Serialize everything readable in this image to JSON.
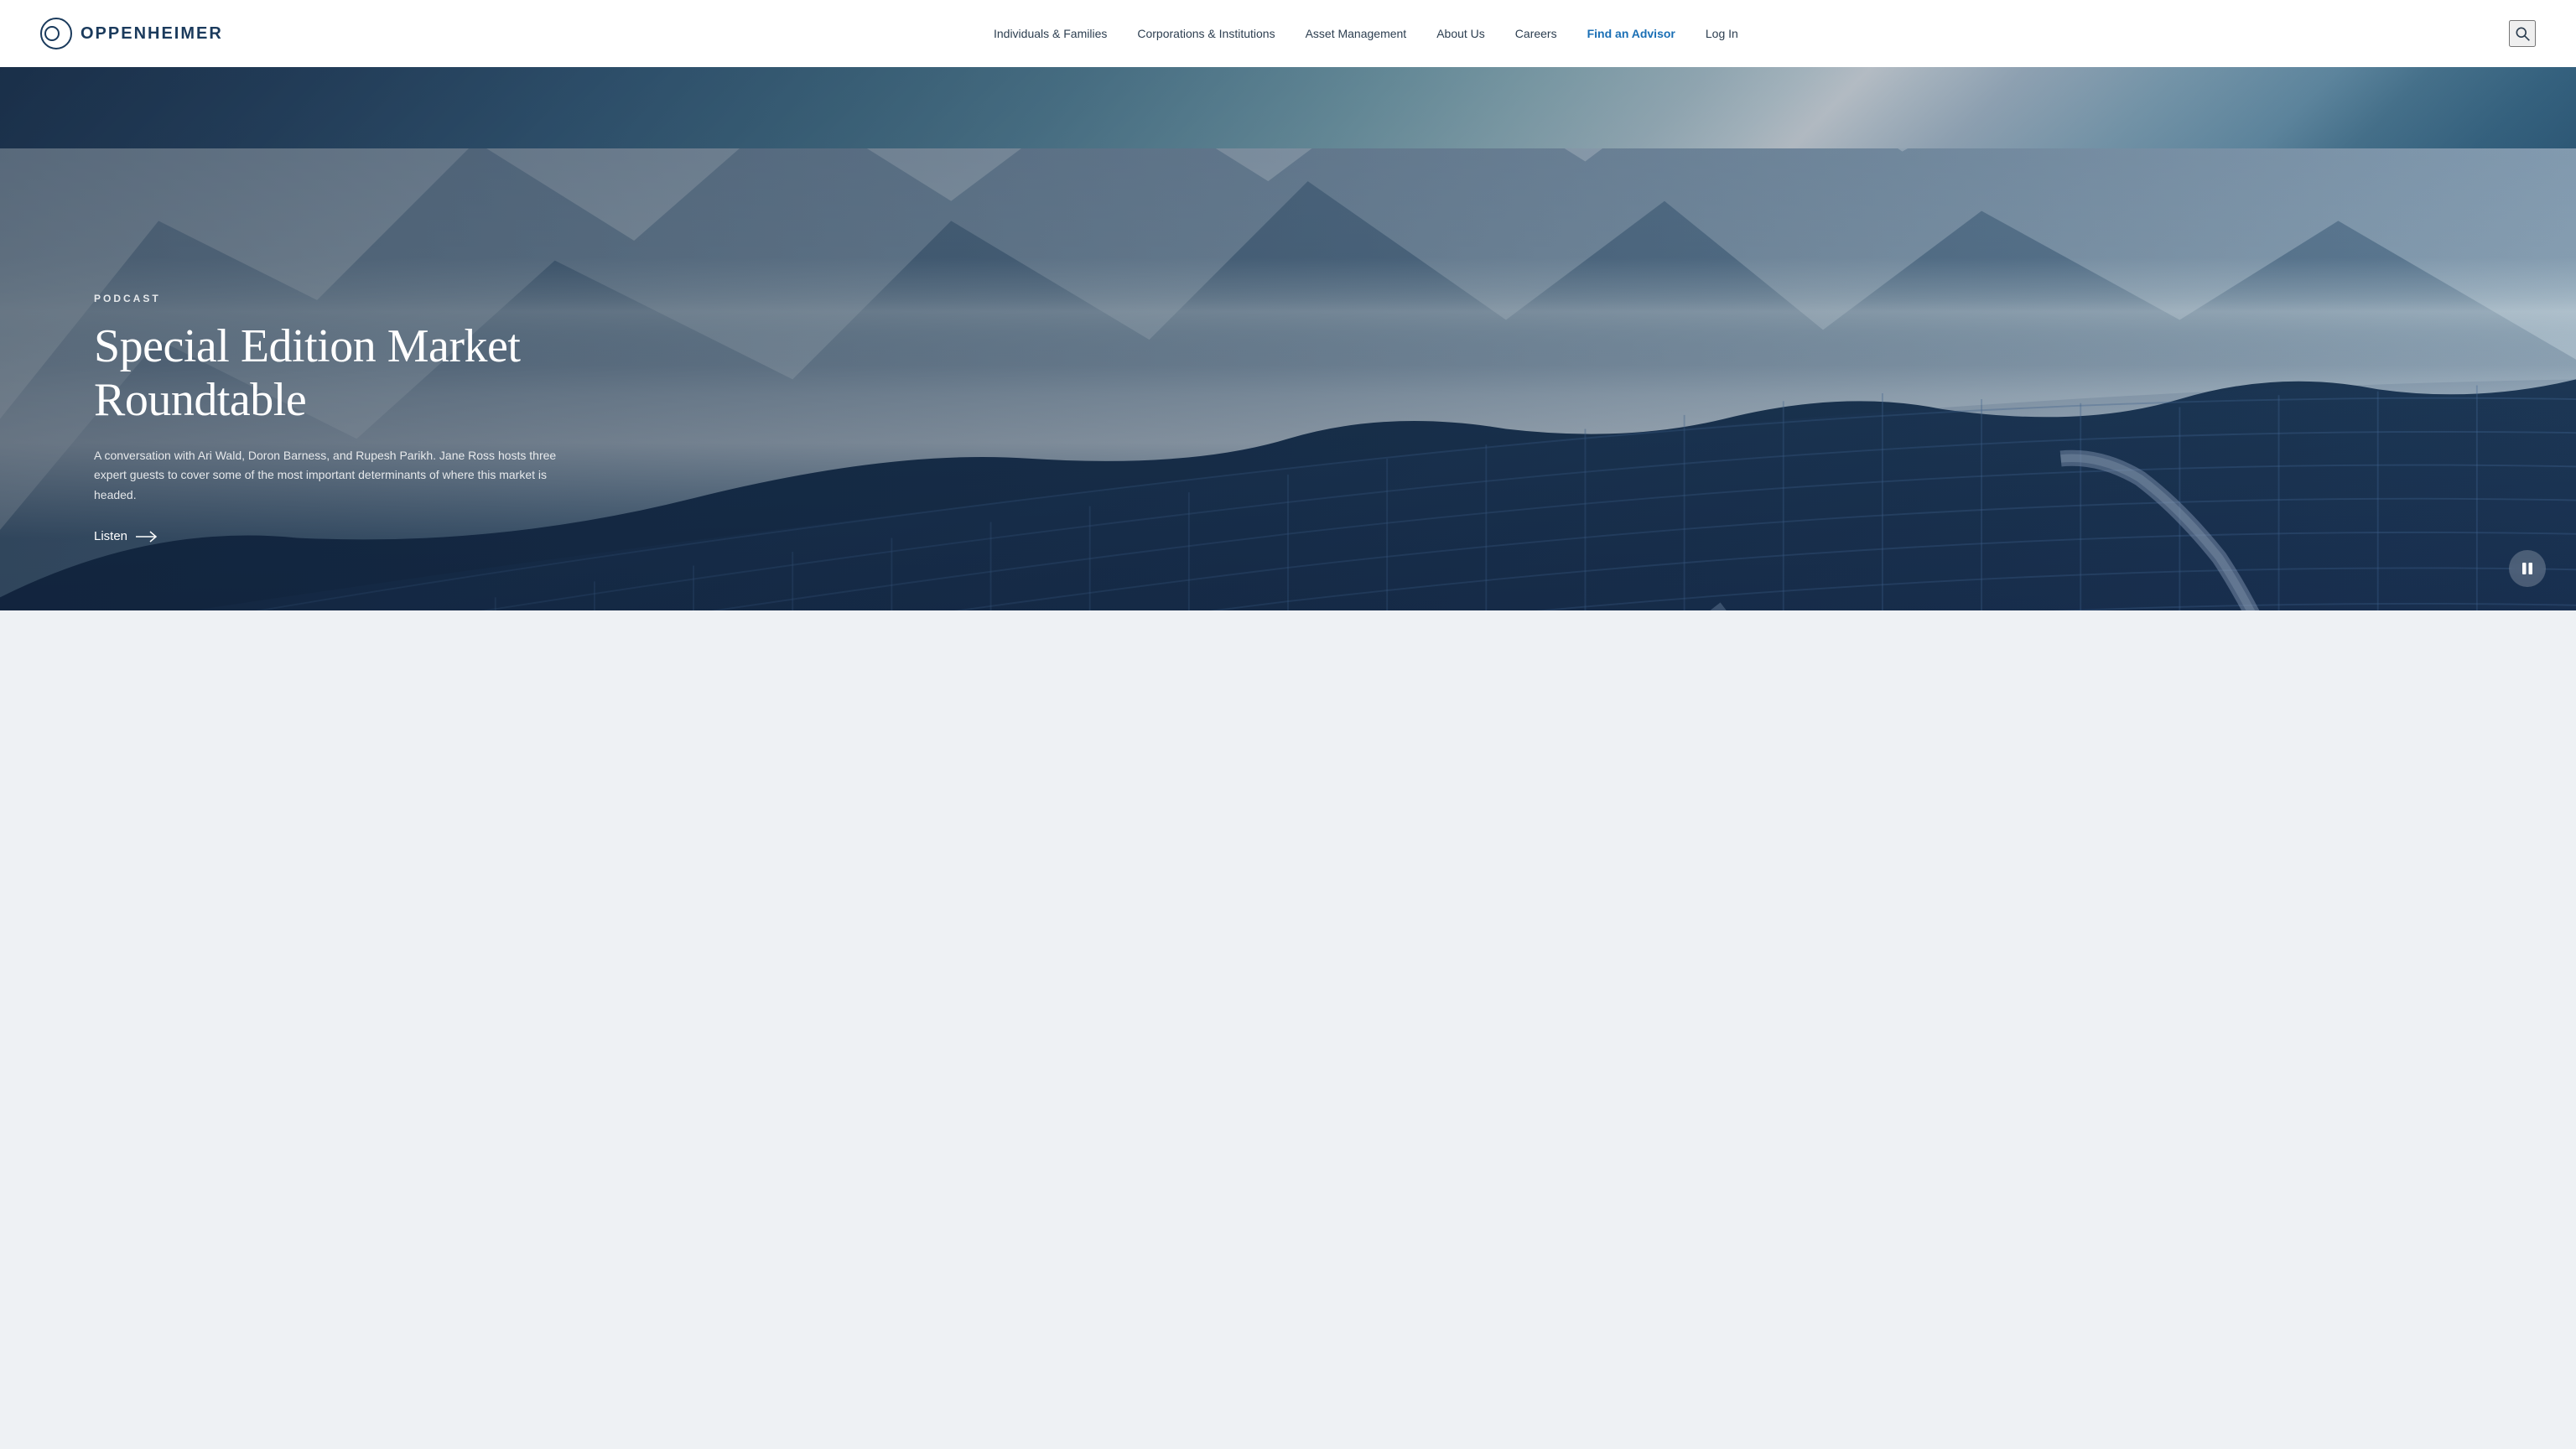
{
  "header": {
    "logo_text": "OPPENHEIMER",
    "nav": {
      "items": [
        {
          "id": "individuals",
          "label": "Individuals & Families",
          "highlight": false
        },
        {
          "id": "corporations",
          "label": "Corporations & Institutions",
          "highlight": false
        },
        {
          "id": "asset-management",
          "label": "Asset Management",
          "highlight": false
        },
        {
          "id": "about-us",
          "label": "About Us",
          "highlight": false
        },
        {
          "id": "careers",
          "label": "Careers",
          "highlight": false
        },
        {
          "id": "find-advisor",
          "label": "Find an Advisor",
          "highlight": true
        },
        {
          "id": "login",
          "label": "Log In",
          "highlight": false
        }
      ]
    },
    "search_aria": "Search"
  },
  "hero": {
    "label": "PODCAST",
    "title": "Special Edition Market Roundtable",
    "description": "A conversation with Ari Wald, Doron Barness, and Rupesh Parikh. Jane Ross hosts three expert guests to cover some of the most important determinants of where this market is headed.",
    "cta_text": "Listen",
    "cta_aria": "Listen to podcast",
    "pause_aria": "Pause slideshow"
  }
}
